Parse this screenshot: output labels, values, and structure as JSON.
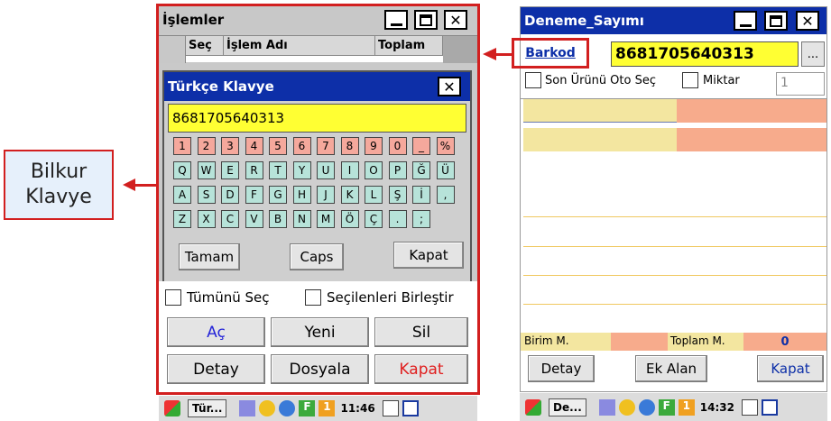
{
  "callout": {
    "line1": "Bilkur",
    "line2": "Klavye"
  },
  "left": {
    "title": "İşlemler",
    "columns": [
      "Seç",
      "İşlem Adı",
      "Toplam"
    ],
    "keyboard": {
      "title": "Türkçe Klavye",
      "value": "8681705640313",
      "rows": [
        [
          "1",
          "2",
          "3",
          "4",
          "5",
          "6",
          "7",
          "8",
          "9",
          "0",
          "_",
          "%"
        ],
        [
          "Q",
          "W",
          "E",
          "R",
          "T",
          "Y",
          "U",
          "I",
          "O",
          "P",
          "Ğ",
          "Ü"
        ],
        [
          "A",
          "S",
          "D",
          "F",
          "G",
          "H",
          "J",
          "K",
          "L",
          "Ş",
          "İ",
          ","
        ],
        [
          "Z",
          "X",
          "C",
          "V",
          "B",
          "N",
          "M",
          "Ö",
          "Ç",
          ".",
          ";"
        ]
      ],
      "ok": "Tamam",
      "caps": "Caps",
      "close": "Kapat"
    },
    "select_all": "Tümünü Seç",
    "merge_selected": "Seçilenleri Birleştir",
    "buttons": {
      "open": "Aç",
      "new": "Yeni",
      "delete": "Sil",
      "detail": "Detay",
      "file": "Dosyala",
      "close": "Kapat"
    },
    "taskbar": {
      "app": "Tür...",
      "time": "11:46",
      "badge": "F",
      "num": "1"
    }
  },
  "right": {
    "title": "Deneme_Sayımı",
    "barcode_label": "Barkod",
    "barcode_value": "8681705640313",
    "browse": "...",
    "last_product": "Son Ürünü",
    "auto_select": "Oto Seç",
    "quantity_label": "Miktar",
    "quantity_value": "1",
    "unit_label": "Birim M.",
    "total_label": "Toplam M.",
    "total_value": "0",
    "buttons": {
      "detail": "Detay",
      "extra": "Ek Alan",
      "close": "Kapat"
    },
    "taskbar": {
      "app": "De...",
      "time": "14:32",
      "badge": "F",
      "num": "1"
    }
  },
  "colors": {
    "accent": "#d21f1f",
    "title_blue": "#0d2fa8",
    "field_yellow": "#ffff33",
    "salmon": "#f7ab8c",
    "pale_yellow": "#f3e6a0"
  }
}
